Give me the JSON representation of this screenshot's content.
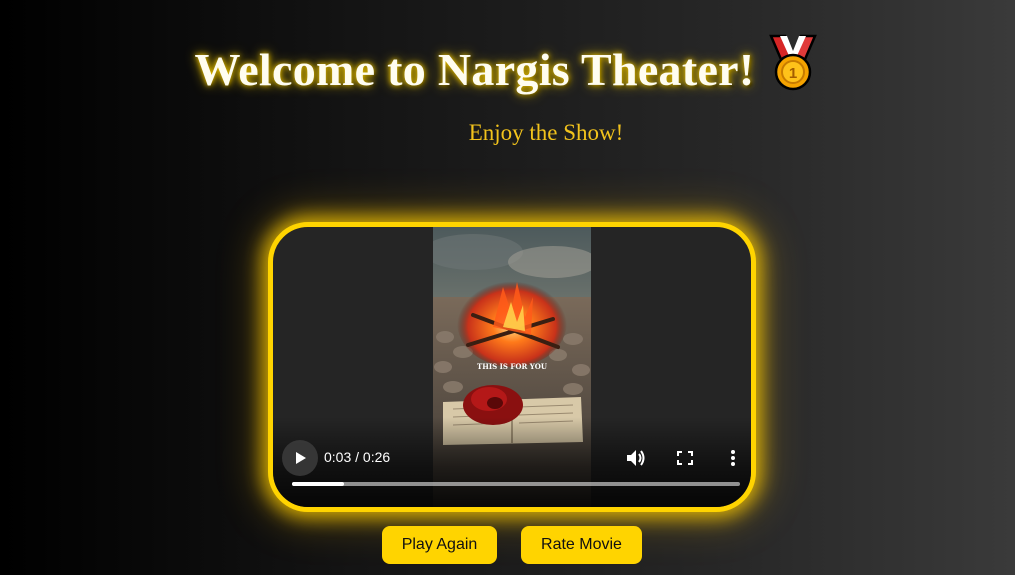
{
  "header": {
    "title": "Welcome to Nargis Theater!",
    "title_emoji": "sports-medal-icon",
    "subtitle": "Enjoy the Show!"
  },
  "video": {
    "overlay_text": "THIS IS FOR YOU",
    "current_time": "0:03",
    "duration": "0:26",
    "time_display": "0:03 / 0:26",
    "progress_fraction": 0.115,
    "controls": {
      "play": "play-icon",
      "volume": "volume-icon",
      "fullscreen": "fullscreen-icon",
      "more": "more-options-icon"
    }
  },
  "actions": {
    "play_again_label": "Play Again",
    "rate_movie_label": "Rate Movie"
  },
  "colors": {
    "accent": "#ffd400",
    "subtitle": "#f2c31c",
    "title": "#fffdf0"
  }
}
